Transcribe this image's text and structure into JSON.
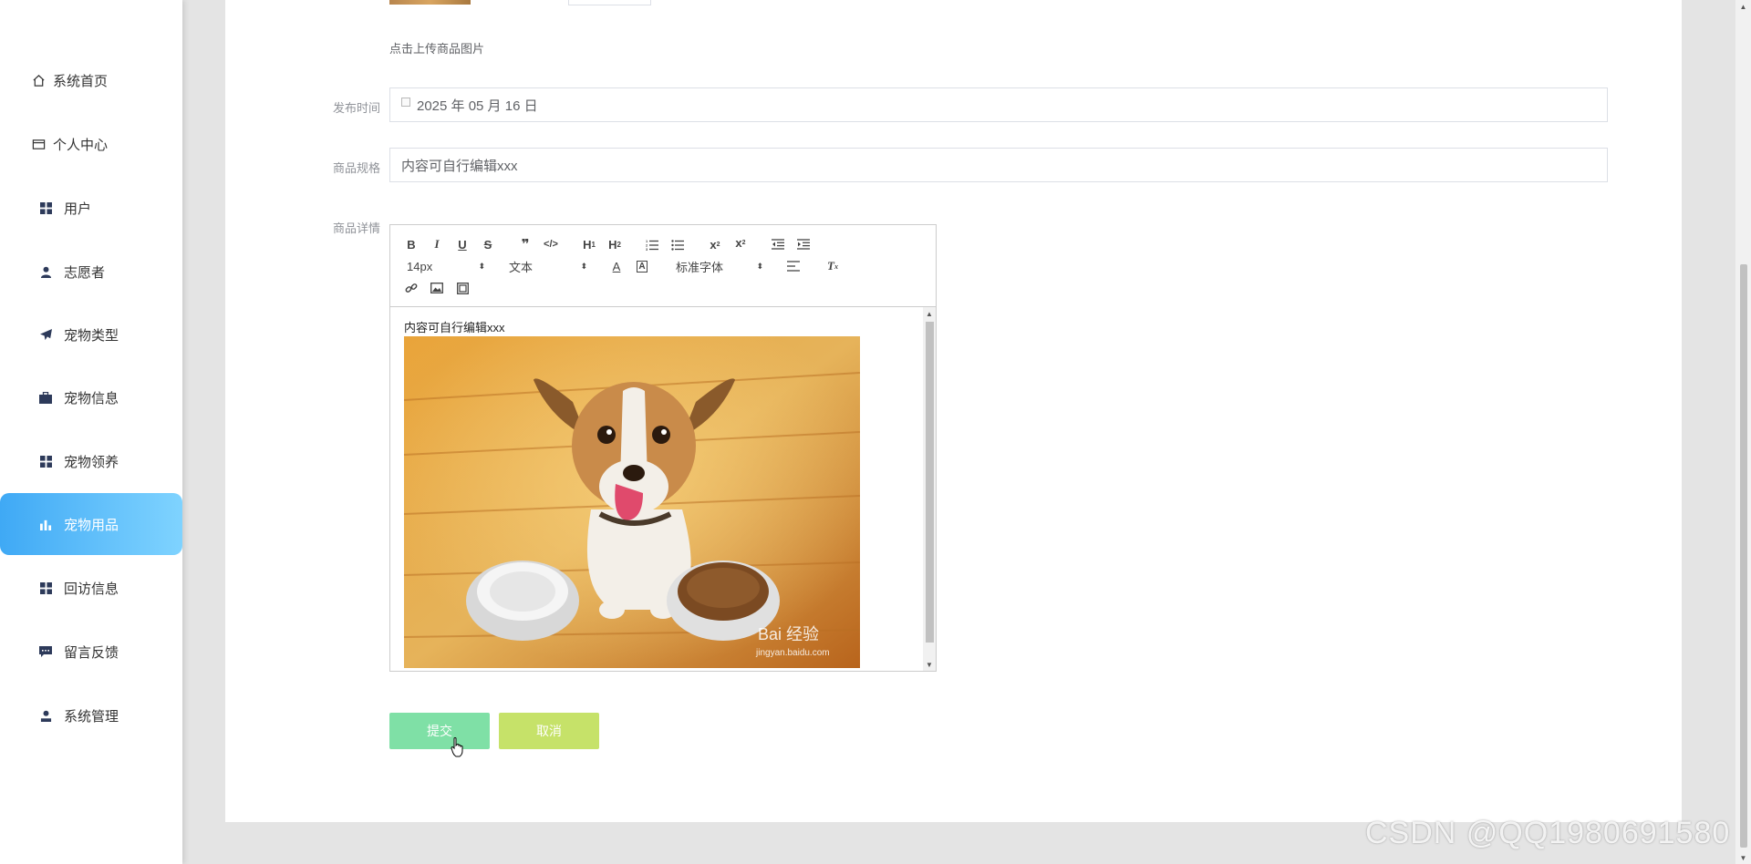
{
  "sidebar": {
    "items": [
      {
        "label": "系统首页",
        "icon": "home-icon"
      },
      {
        "label": "个人中心",
        "icon": "card-icon"
      },
      {
        "label": "用户",
        "icon": "grid-icon"
      },
      {
        "label": "志愿者",
        "icon": "person-icon"
      },
      {
        "label": "宠物类型",
        "icon": "paper-plane-icon"
      },
      {
        "label": "宠物信息",
        "icon": "briefcase-icon"
      },
      {
        "label": "宠物领养",
        "icon": "grid-icon"
      },
      {
        "label": "宠物用品",
        "icon": "bar-chart-icon",
        "active": true
      },
      {
        "label": "回访信息",
        "icon": "grid-icon"
      },
      {
        "label": "留言反馈",
        "icon": "chat-icon"
      },
      {
        "label": "系统管理",
        "icon": "user-admin-icon"
      }
    ]
  },
  "form": {
    "upload_hint": "点击上传商品图片",
    "publish_time": {
      "label": "发布时间",
      "value": "2025 年 05 月 16 日"
    },
    "spec": {
      "label": "商品规格",
      "value": "内容可自行编辑xxx"
    },
    "detail": {
      "label": "商品详情"
    }
  },
  "editor": {
    "font_size": "14px",
    "text_type": "文本",
    "font_family": "标准字体",
    "content_text": "内容可自行编辑xxx",
    "image_watermark": "Bai 经验",
    "image_watermark_url": "jingyan.baidu.com"
  },
  "buttons": {
    "submit": "提交",
    "cancel": "取消"
  },
  "watermark": "CSDN @QQ1980691580",
  "colors": {
    "active_gradient_start": "#3fa9f5",
    "active_gradient_end": "#7fd3ff",
    "submit_bg": "#7fe0a6",
    "cancel_bg": "#c6e269"
  }
}
